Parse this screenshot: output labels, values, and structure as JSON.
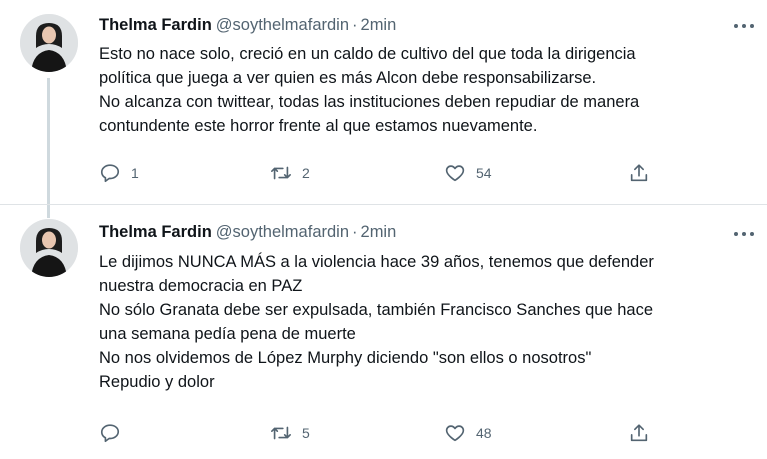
{
  "tweets": [
    {
      "author_name": "Thelma Fardin",
      "handle": "@soythelmafardin",
      "separator": "·",
      "time": "2min",
      "text_lines": [
        "Esto no nace solo, creció en un caldo de cultivo del que toda la dirigencia",
        "política que juega a ver quien es más Alcon debe responsabilizarse.",
        "No alcanza con twittear, todas las instituciones deben repudiar de manera",
        "contundente este horror frente al que estamos nuevamente."
      ],
      "replies": "1",
      "retweets": "2",
      "likes": "54",
      "icons": {
        "reply": "reply-icon",
        "retweet": "retweet-icon",
        "like": "heart-icon",
        "share": "share-icon",
        "more": "more-icon"
      }
    },
    {
      "author_name": "Thelma Fardin",
      "handle": "@soythelmafardin",
      "separator": "·",
      "time": "2min",
      "text_lines": [
        "Le dijimos NUNCA MÁS a la violencia hace 39 años, tenemos que defender",
        "nuestra democracia en PAZ",
        "No sólo Granata debe ser expulsada, también Francisco Sanches que hace",
        "una semana pedía pena de muerte",
        "No nos olvidemos de López Murphy diciendo \"son ellos o nosotros\"",
        "Repudio y dolor"
      ],
      "replies": "",
      "retweets": "5",
      "likes": "48",
      "icons": {
        "reply": "reply-icon",
        "retweet": "retweet-icon",
        "like": "heart-icon",
        "share": "share-icon",
        "more": "more-icon"
      }
    }
  ],
  "colors": {
    "text": "#0f1419",
    "secondary": "#536471",
    "thread_line": "#cfd9de",
    "divider": "#dfe3e6"
  }
}
